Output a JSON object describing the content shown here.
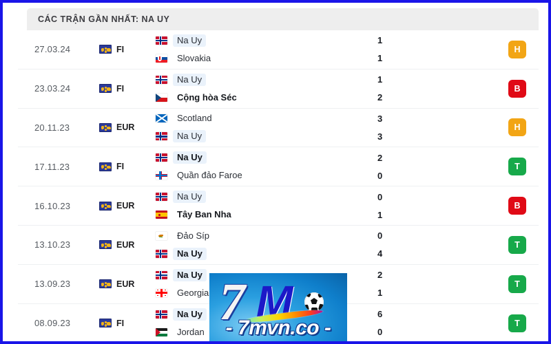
{
  "header": {
    "title": "CÁC TRẬN GẦN NHẤT: NA UY"
  },
  "colors": {
    "frame_border": "#1a15e8",
    "header_bg": "#eeeeee",
    "badge_draw": "#f2a515",
    "badge_loss": "#e00a16",
    "badge_win": "#17a94a",
    "highlight": "#eaf2fb"
  },
  "matches": [
    {
      "date": "27.03.24",
      "competition": "FI",
      "competition_icon": "world-globe-icon",
      "home": {
        "name": "Na Uy",
        "flag": "no",
        "highlight": true,
        "bold": false
      },
      "away": {
        "name": "Slovakia",
        "flag": "sk",
        "highlight": false,
        "bold": false
      },
      "home_score": "1",
      "away_score": "1",
      "result": "H"
    },
    {
      "date": "23.03.24",
      "competition": "FI",
      "competition_icon": "world-globe-icon",
      "home": {
        "name": "Na Uy",
        "flag": "no",
        "highlight": true,
        "bold": false
      },
      "away": {
        "name": "Cộng hòa Séc",
        "flag": "cz",
        "highlight": false,
        "bold": true
      },
      "home_score": "1",
      "away_score": "2",
      "result": "B"
    },
    {
      "date": "20.11.23",
      "competition": "EUR",
      "competition_icon": "world-globe-icon",
      "home": {
        "name": "Scotland",
        "flag": "sct",
        "highlight": false,
        "bold": false
      },
      "away": {
        "name": "Na Uy",
        "flag": "no",
        "highlight": true,
        "bold": false
      },
      "home_score": "3",
      "away_score": "3",
      "result": "H"
    },
    {
      "date": "17.11.23",
      "competition": "FI",
      "competition_icon": "world-globe-icon",
      "home": {
        "name": "Na Uy",
        "flag": "no",
        "highlight": true,
        "bold": true
      },
      "away": {
        "name": "Quần đảo Faroe",
        "flag": "fo",
        "highlight": false,
        "bold": false
      },
      "home_score": "2",
      "away_score": "0",
      "result": "T"
    },
    {
      "date": "16.10.23",
      "competition": "EUR",
      "competition_icon": "world-globe-icon",
      "home": {
        "name": "Na Uy",
        "flag": "no",
        "highlight": true,
        "bold": false
      },
      "away": {
        "name": "Tây Ban Nha",
        "flag": "es",
        "highlight": false,
        "bold": true
      },
      "home_score": "0",
      "away_score": "1",
      "result": "B"
    },
    {
      "date": "13.10.23",
      "competition": "EUR",
      "competition_icon": "world-globe-icon",
      "home": {
        "name": "Đảo Síp",
        "flag": "cy",
        "highlight": false,
        "bold": false
      },
      "away": {
        "name": "Na Uy",
        "flag": "no",
        "highlight": true,
        "bold": true
      },
      "home_score": "0",
      "away_score": "4",
      "result": "T"
    },
    {
      "date": "13.09.23",
      "competition": "EUR",
      "competition_icon": "world-globe-icon",
      "home": {
        "name": "Na Uy",
        "flag": "no",
        "highlight": true,
        "bold": true
      },
      "away": {
        "name": "Georgia",
        "flag": "ge",
        "highlight": false,
        "bold": false
      },
      "home_score": "2",
      "away_score": "1",
      "result": "T"
    },
    {
      "date": "08.09.23",
      "competition": "FI",
      "competition_icon": "world-globe-icon",
      "home": {
        "name": "Na Uy",
        "flag": "no",
        "highlight": true,
        "bold": true
      },
      "away": {
        "name": "Jordan",
        "flag": "jo",
        "highlight": false,
        "bold": false
      },
      "home_score": "6",
      "away_score": "0",
      "result": "T"
    }
  ],
  "watermark": {
    "seven": "7",
    "m": "M",
    "domain": "- 7mvn.co -",
    "ball_icon": "soccer-ball-icon"
  }
}
